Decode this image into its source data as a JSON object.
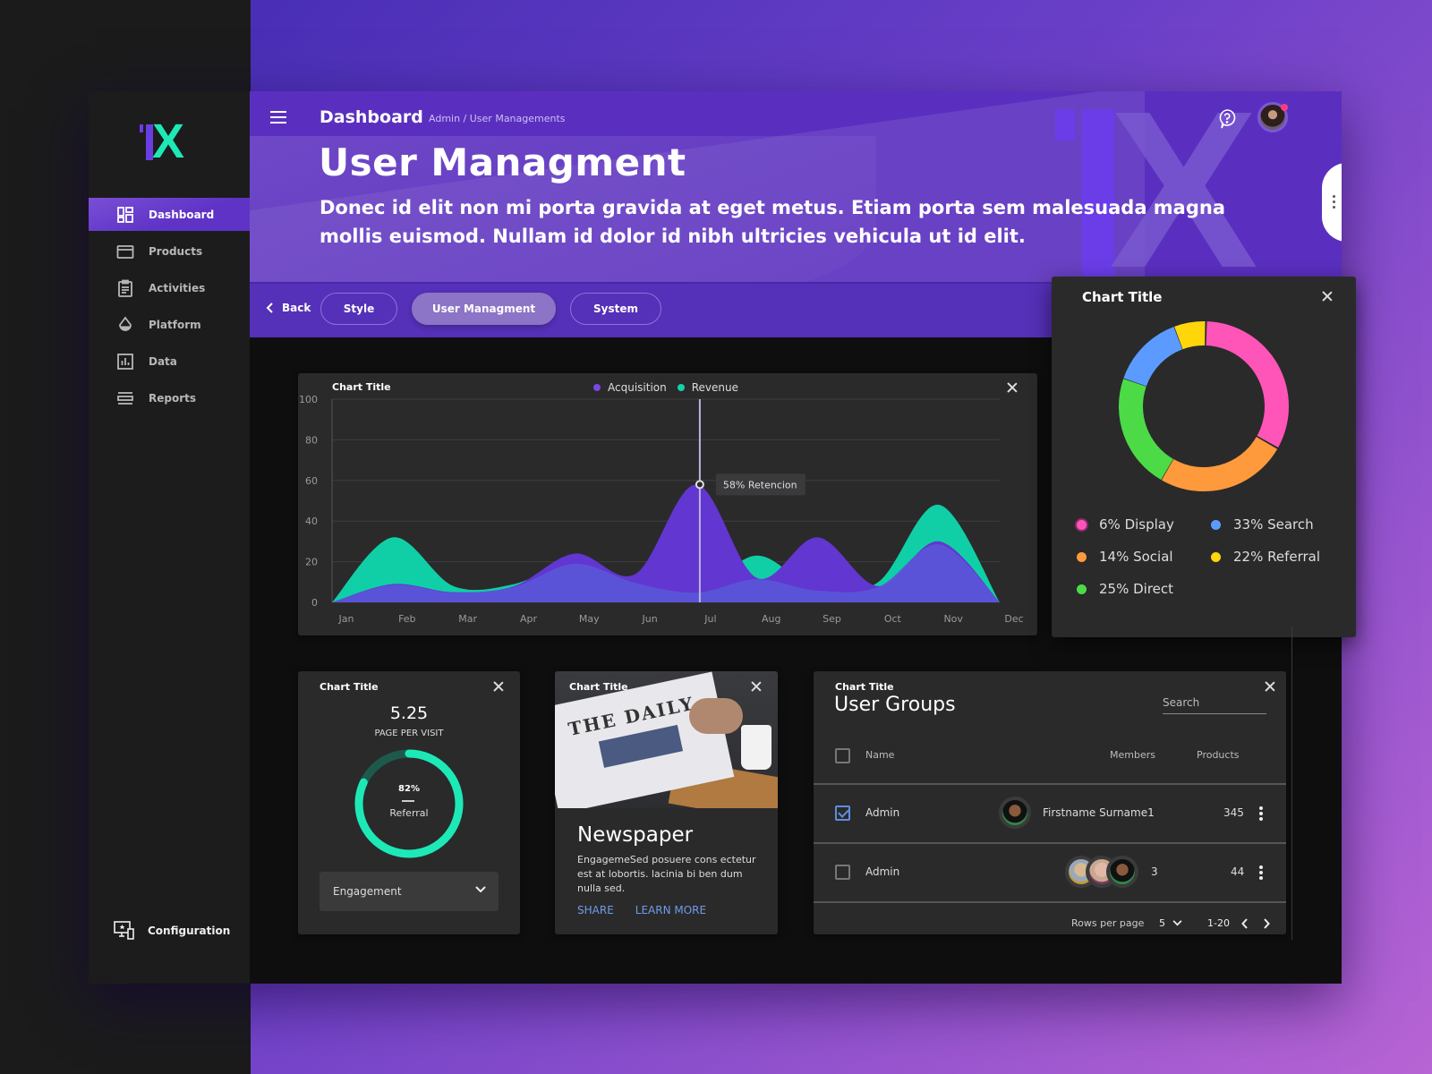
{
  "sidebar": {
    "logo": {
      "mark": "1",
      "letter": "X"
    },
    "items": [
      {
        "label": "Dashboard",
        "icon": "dashboard-grid-icon",
        "active": true
      },
      {
        "label": "Products",
        "icon": "credit-card-icon",
        "active": false
      },
      {
        "label": "Activities",
        "icon": "clipboard-icon",
        "active": false
      },
      {
        "label": "Platform",
        "icon": "drop-icon",
        "active": false
      },
      {
        "label": "Data",
        "icon": "bar-chart-icon",
        "active": false
      },
      {
        "label": "Reports",
        "icon": "list-icon",
        "active": false
      }
    ],
    "config_label": "Configuration"
  },
  "header": {
    "section": "Dashboard",
    "breadcrumb": "Admin  /  User Managements",
    "title": "User Managment",
    "description": "Donec id elit non mi porta gravida at eget metus. Etiam porta sem malesuada magna mollis euismod. Nullam id dolor id nibh ultricies vehicula ut id elit.",
    "notification_dot_color": "#ff3c7e"
  },
  "tabs": {
    "back_label": "Back",
    "items": [
      {
        "label": "Style",
        "active": false
      },
      {
        "label": "User Managment",
        "active": true
      },
      {
        "label": "System",
        "active": false
      }
    ]
  },
  "colors": {
    "brand_purple": "#5a2fbf",
    "accent_teal": "#1de9b6",
    "acquisition": "#5a3fd0",
    "revenue": "#14d3a8"
  },
  "chart_data": [
    {
      "type": "area",
      "title": "Chart Title",
      "categories": [
        "Jan",
        "Feb",
        "Mar",
        "Apr",
        "May",
        "Jun",
        "Jul",
        "Aug",
        "Sep",
        "Oct",
        "Nov",
        "Dec"
      ],
      "ylim": [
        0,
        100
      ],
      "yticks": [
        0,
        20,
        40,
        60,
        80,
        100
      ],
      "grid": true,
      "legend_position": "top-center",
      "series": [
        {
          "name": "Acquisition",
          "color": "#6236d0",
          "values": [
            0,
            9,
            5,
            8,
            24,
            14,
            58,
            12,
            32,
            8,
            30,
            0
          ]
        },
        {
          "name": "Revenue",
          "color": "#10cfa6",
          "values": [
            0,
            32,
            8,
            9,
            20,
            10,
            5,
            23,
            6,
            10,
            48,
            0
          ]
        }
      ],
      "annotation": {
        "category": "Jul",
        "value": 58,
        "label": "58% Retencion"
      }
    },
    {
      "type": "pie",
      "title": "Chart Title",
      "donut": true,
      "slices": [
        {
          "label": "Display",
          "percent": 6,
          "display": "6% Display",
          "color": "#ff55b8",
          "arc_share": 33
        },
        {
          "label": "Social",
          "percent": 14,
          "display": "14% Social",
          "color": "#ff9a3c",
          "arc_share": 25
        },
        {
          "label": "Direct",
          "percent": 25,
          "display": "25% Direct",
          "color": "#4cdb46",
          "arc_share": 22
        },
        {
          "label": "Search",
          "percent": 33,
          "display": "33% Search",
          "color": "#5b9bff",
          "arc_share": 14
        },
        {
          "label": "Referral",
          "percent": 22,
          "display": "22% Referral",
          "color": "#ffd60a",
          "arc_share": 6
        }
      ]
    },
    {
      "type": "gauge",
      "title": "Chart Title",
      "value": 82,
      "value_label": "82%",
      "label": "Referral",
      "metric": "5.25",
      "metric_label": "PAGE PER VISIT"
    }
  ],
  "gauge_card": {
    "title": "Chart Title",
    "metric": "5.25",
    "metric_label": "PAGE PER VISIT",
    "percent_label": "82%",
    "percent": 82,
    "label": "Referral",
    "select_value": "Engagement"
  },
  "news_card": {
    "title": "Chart Title",
    "headline": "Newspaper",
    "paper_masthead": "THE DAILY",
    "body": "EngagemeSed posuere cons ectetur est at lobortis. lacinia bi ben dum nulla sed.",
    "share": "SHARE",
    "learn_more": "LEARN MORE"
  },
  "table_card": {
    "title": "Chart Title",
    "heading": "User Groups",
    "search_placeholder": "Search",
    "columns": [
      "Name",
      "Members",
      "Products"
    ],
    "rows": [
      {
        "checked": true,
        "name": "Admin",
        "members": "Firstname Surname1",
        "products": "345"
      },
      {
        "checked": false,
        "name": "Admin",
        "members": "3",
        "products": "44"
      }
    ],
    "rows_per_page_label": "Rows per page",
    "rows_per_page": "5",
    "range": "1-20"
  }
}
